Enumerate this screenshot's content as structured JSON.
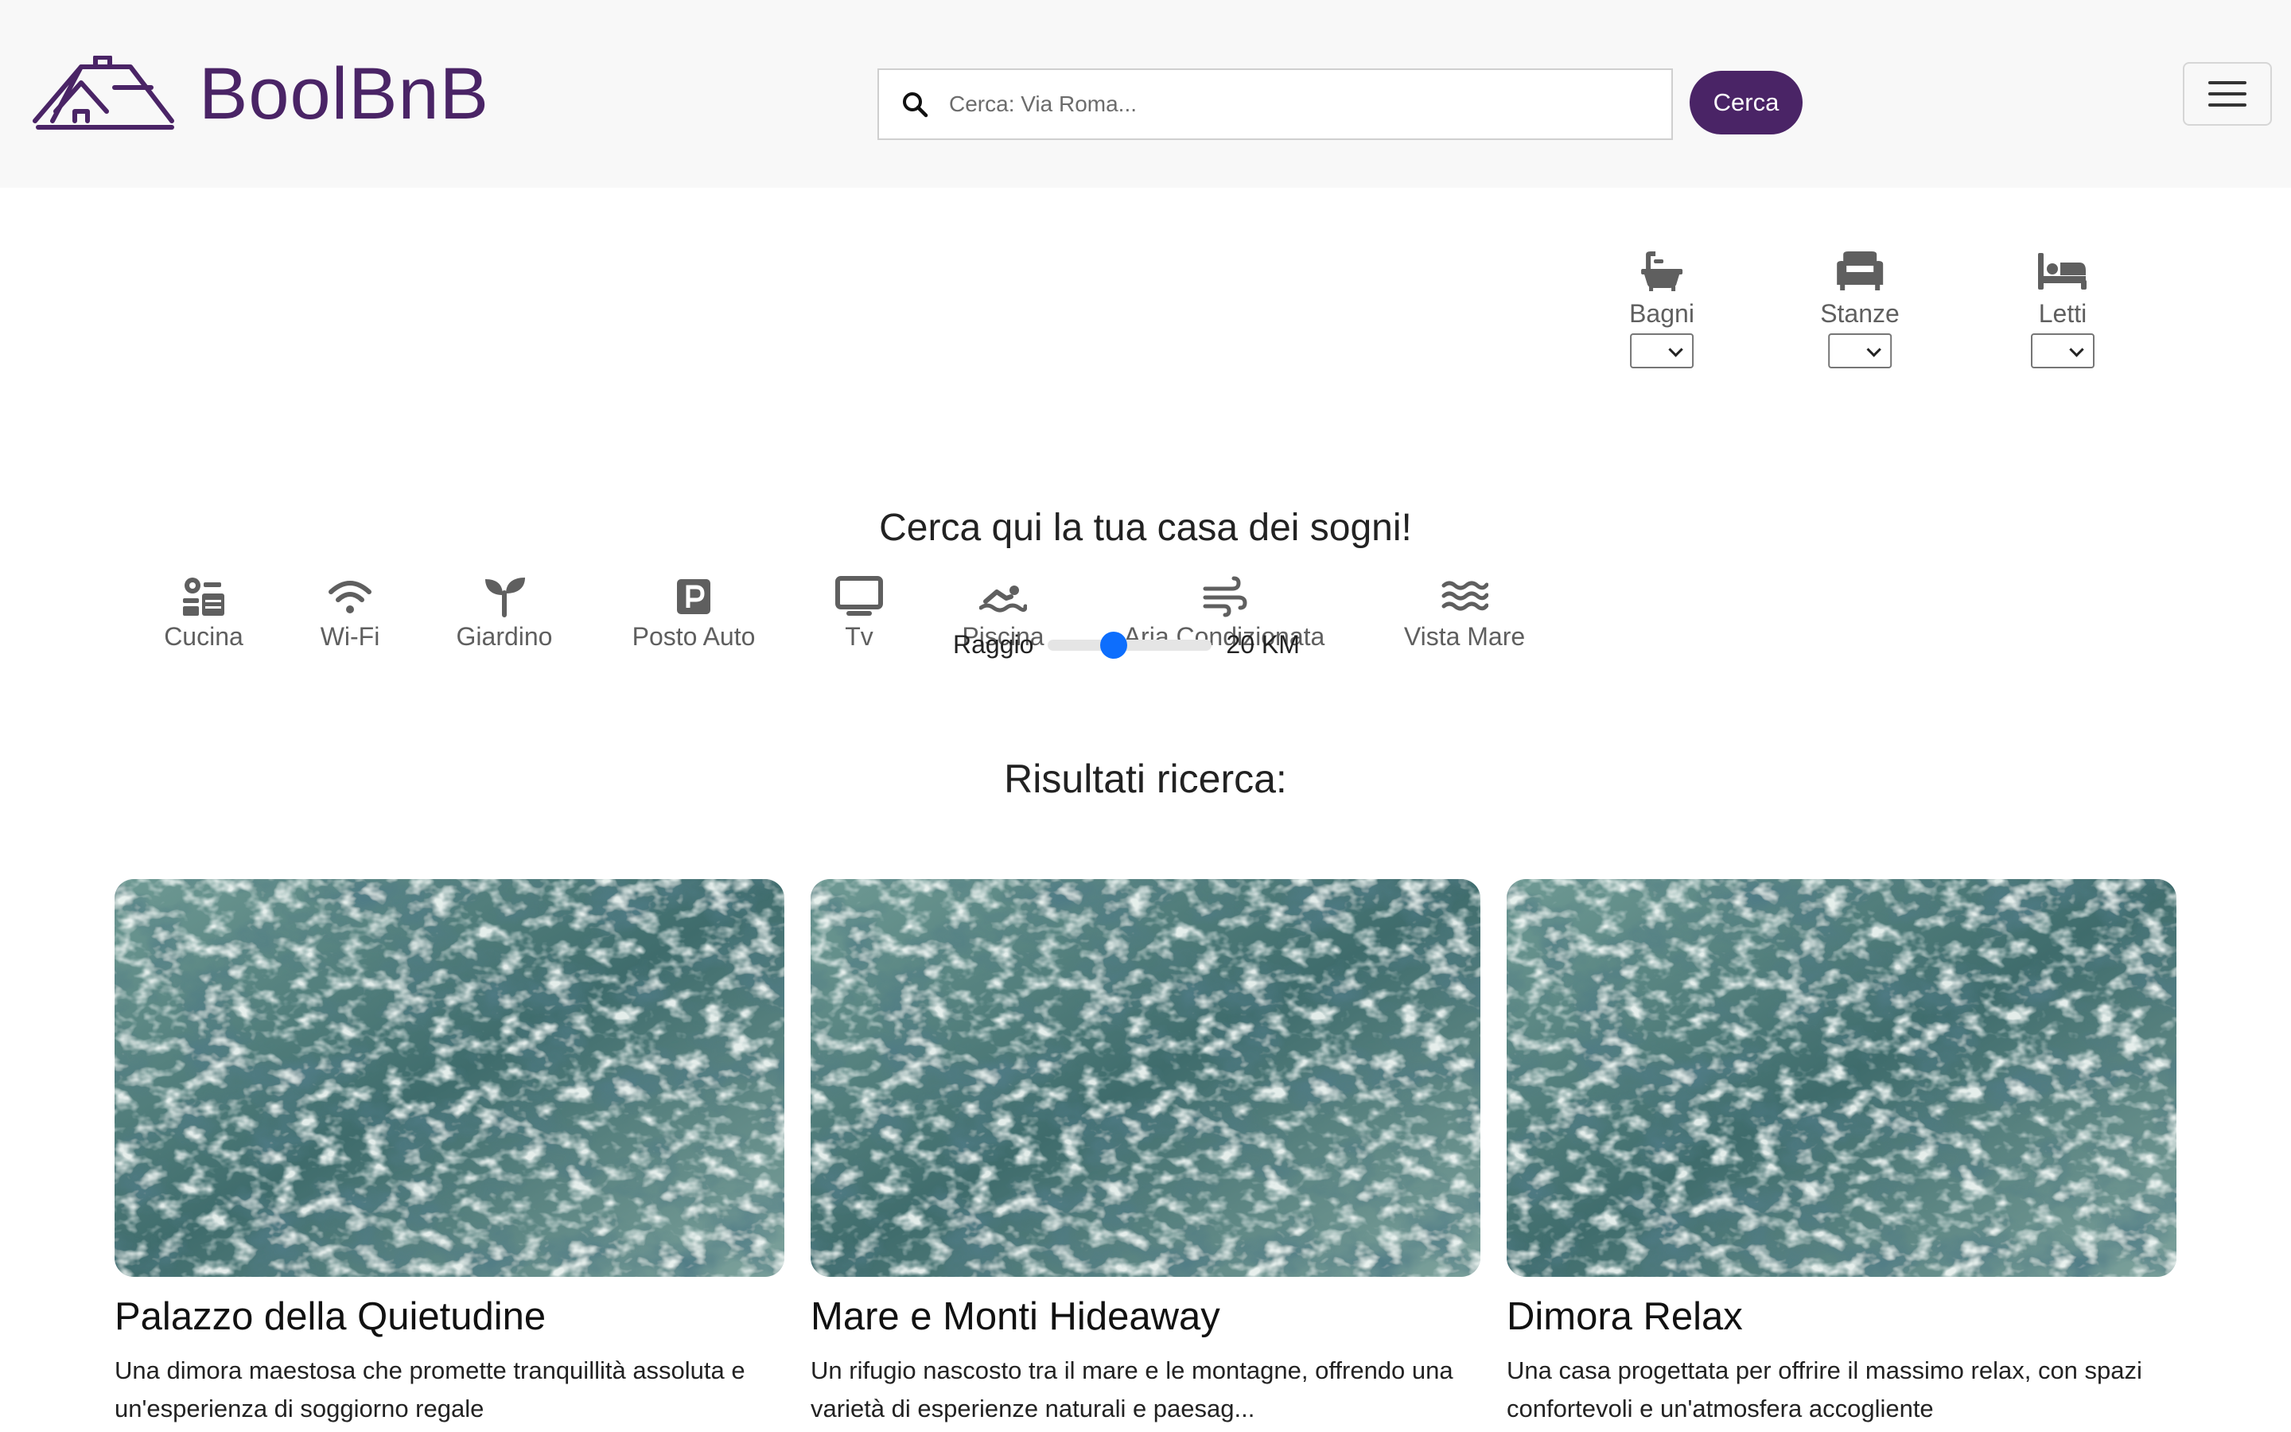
{
  "header": {
    "logo_text": "BoolBnB",
    "search_placeholder": "Cerca: Via Roma...",
    "search_button": "Cerca"
  },
  "filters": {
    "amenities": [
      "Cucina",
      "Wi-Fi",
      "Giardino",
      "Posto Auto",
      "Tv",
      "Piscina",
      "Aria Condizionata",
      "Vista Mare"
    ],
    "selects": [
      {
        "label": "Bagni",
        "value": ""
      },
      {
        "label": "Stanze",
        "value": ""
      },
      {
        "label": "Letti",
        "value": ""
      }
    ]
  },
  "main": {
    "title": "Cerca qui la tua casa dei sogni!",
    "radius_label": "Raggio",
    "radius_value": "20 KM",
    "radius_fraction": 0.4,
    "results_title": "Risultati ricerca:"
  },
  "cards": [
    {
      "title": "Palazzo della Quietudine",
      "description_line1": "Una dimora maestosa che promette tranquillità assoluta e",
      "description_line2": "un'esperienza di soggiorno regale"
    },
    {
      "title": "Mare e Monti Hideaway",
      "description_line1": "Un rifugio nascosto tra il mare e le montagne, offrendo una",
      "description_line2": "varietà di esperienze naturali e paesag..."
    },
    {
      "title": "Dimora Relax",
      "description_line1": "Una casa progettata per offrire il massimo relax, con spazi",
      "description_line2": "confortevoli e un'atmosfera accogliente"
    }
  ],
  "colors": {
    "brand": "#4a2466",
    "slider_thumb": "#0d6efd",
    "header_bg": "#f8f8f8"
  },
  "icons": {
    "amenities": [
      "kitchen-icon",
      "wifi-icon",
      "seedling-icon",
      "parking-icon",
      "tv-icon",
      "swimmer-icon",
      "wind-icon",
      "water-icon"
    ],
    "selects": [
      "bath-icon",
      "couch-icon",
      "bed-icon"
    ]
  }
}
